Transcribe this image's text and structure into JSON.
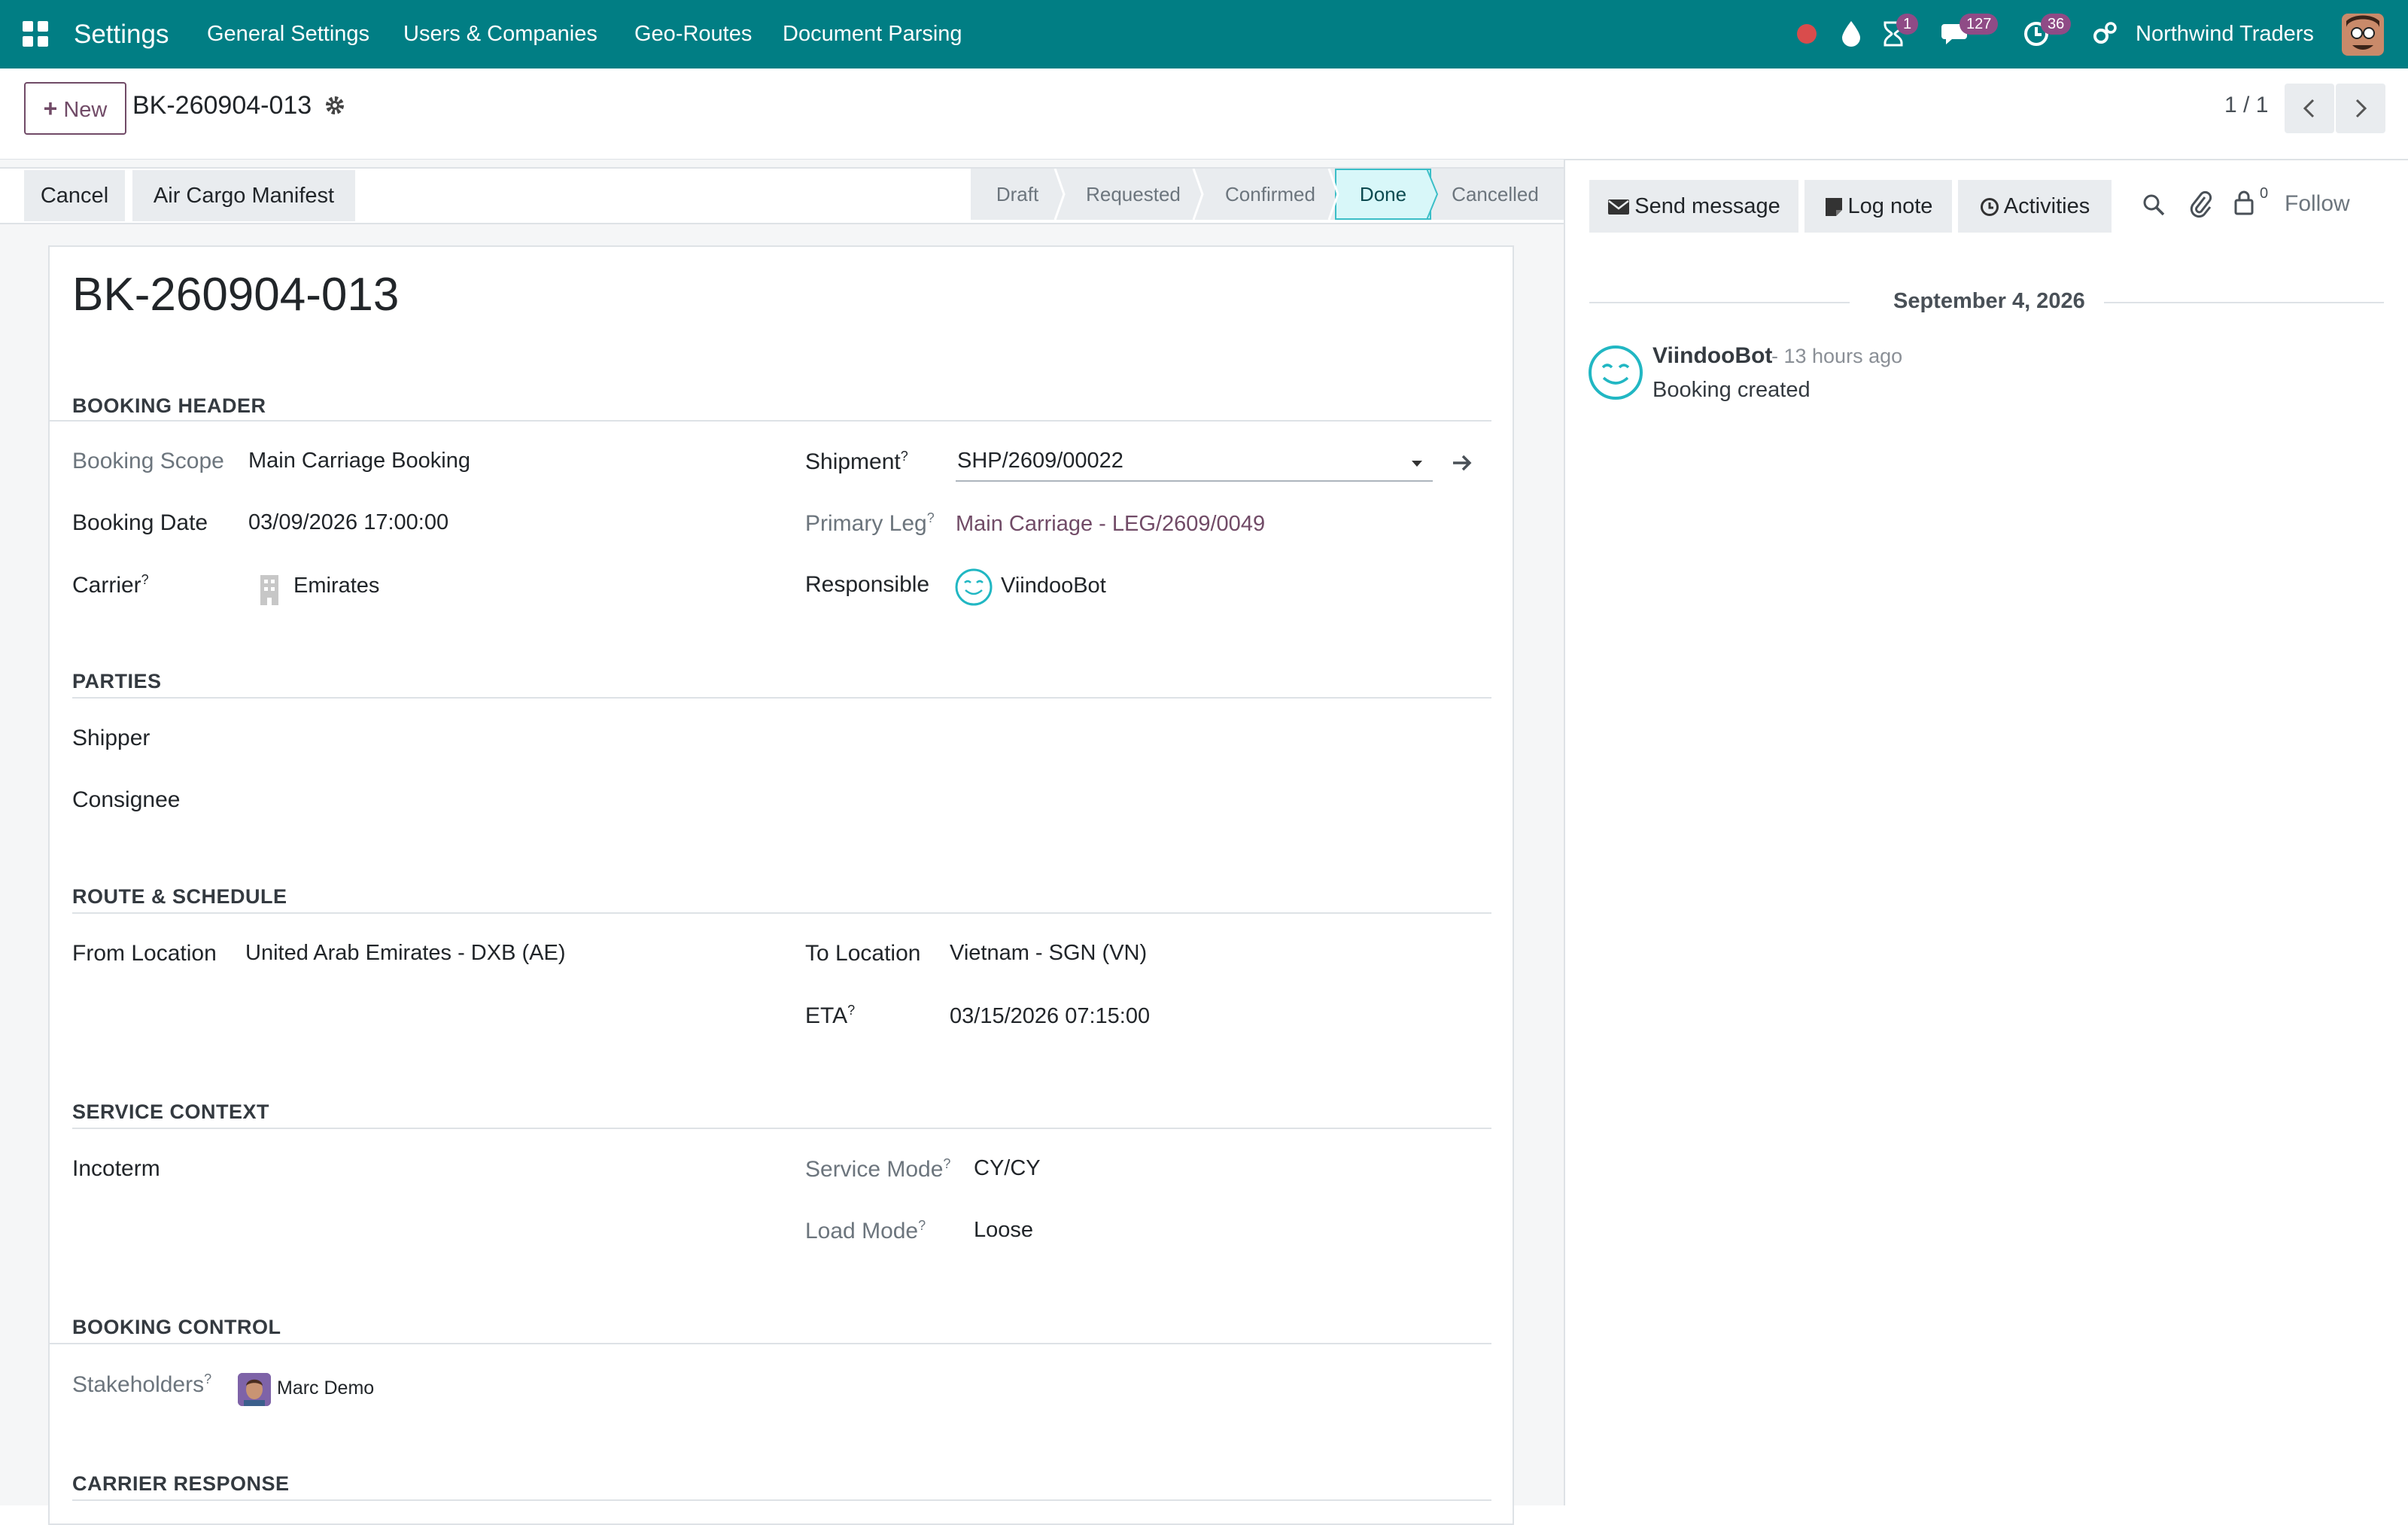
{
  "topbar": {
    "app_title": "Settings",
    "menus": [
      "General Settings",
      "Users & Companies",
      "Geo-Routes",
      "Document Parsing"
    ],
    "activity_badge": "1",
    "messages_badge": "127",
    "clock_badge": "36",
    "company": "Northwind Traders",
    "colors": {
      "bar": "#017e84",
      "badge": "#8f4b86",
      "record_dot": "#d94c4c"
    }
  },
  "control_panel": {
    "new_label": "New",
    "breadcrumb": "BK-260904-013",
    "pager": "1 / 1"
  },
  "status_bar": {
    "buttons": [
      "Cancel",
      "Air Cargo Manifest"
    ],
    "stages": [
      "Draft",
      "Requested",
      "Confirmed",
      "Done",
      "Cancelled"
    ],
    "active_stage": "Done"
  },
  "form": {
    "title": "BK-260904-013",
    "sections": {
      "booking_header": "BOOKING HEADER",
      "parties": "PARTIES",
      "route": "ROUTE & SCHEDULE",
      "service": "SERVICE CONTEXT",
      "control": "BOOKING CONTROL",
      "carrier_response": "CARRIER RESPONSE"
    },
    "fields": {
      "booking_scope_label": "Booking Scope",
      "booking_scope": "Main Carriage Booking",
      "booking_date_label": "Booking Date",
      "booking_date": "03/09/2026 17:00:00",
      "carrier_label": "Carrier",
      "carrier": "Emirates",
      "shipment_label": "Shipment",
      "shipment": "SHP/2609/00022",
      "primary_leg_label": "Primary Leg",
      "primary_leg": "Main Carriage - LEG/2609/0049",
      "responsible_label": "Responsible",
      "responsible": "ViindooBot",
      "shipper_label": "Shipper",
      "consignee_label": "Consignee",
      "from_location_label": "From Location",
      "from_location": "United Arab Emirates - DXB (AE)",
      "to_location_label": "To Location",
      "to_location": "Vietnam - SGN (VN)",
      "eta_label": "ETA",
      "eta": "03/15/2026 07:15:00",
      "incoterm_label": "Incoterm",
      "service_mode_label": "Service Mode",
      "service_mode": "CY/CY",
      "load_mode_label": "Load Mode",
      "load_mode": "Loose",
      "stakeholders_label": "Stakeholders",
      "stakeholder": "Marc Demo",
      "help_mark": "?"
    }
  },
  "chatter": {
    "send_message": "Send message",
    "log_note": "Log note",
    "activities": "Activities",
    "followers_count": "0",
    "follow": "Follow",
    "date_separator": "September 4, 2026",
    "message": {
      "author": "ViindooBot",
      "time": "- 13 hours ago",
      "body": "Booking created"
    }
  }
}
